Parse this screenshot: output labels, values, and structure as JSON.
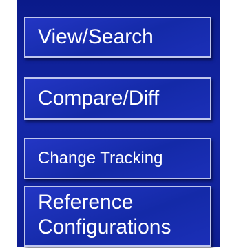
{
  "menu": {
    "items": [
      {
        "label": "View/Search"
      },
      {
        "label": "Compare/Diff"
      },
      {
        "label": "Change Tracking"
      },
      {
        "label_lines": [
          "Reference",
          "Configurations"
        ]
      }
    ]
  },
  "colors": {
    "panel_background": "#1528a8",
    "button_border": "#bfc6ee",
    "text": "#ffffff"
  }
}
